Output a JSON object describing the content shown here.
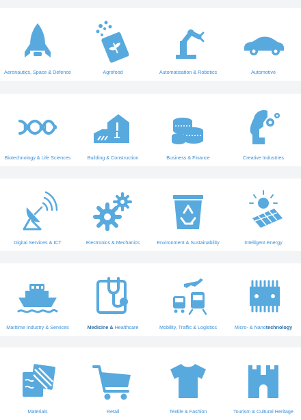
{
  "rows": [
    {
      "tiles": [
        {
          "label": "Aeronautics, Space & Defence",
          "icon": "rocket-icon"
        },
        {
          "label": "Agrofood",
          "icon": "seed-bag-icon"
        },
        {
          "label": "Automatisation & Robotics",
          "icon": "robot-arm-icon"
        },
        {
          "label": "Automotive",
          "icon": "car-icon"
        }
      ]
    },
    {
      "tiles": [
        {
          "label": "Biotechnology & Life Sciences",
          "icon": "dna-icon"
        },
        {
          "label": "Building & Construction",
          "icon": "house-construction-icon"
        },
        {
          "label": "Business & Finance",
          "icon": "coin-stacks-icon"
        },
        {
          "label": "Creative Industries",
          "icon": "head-gears-icon"
        }
      ]
    },
    {
      "tiles": [
        {
          "label": "Digital Services & ICT",
          "icon": "satellite-dish-icon"
        },
        {
          "label": "Electronics & Mechanics",
          "icon": "gears-icon"
        },
        {
          "label": "Environment & Sustainability",
          "icon": "recycle-bin-icon"
        },
        {
          "label": "Intelligent Energy",
          "icon": "solar-panel-icon"
        }
      ]
    },
    {
      "tiles": [
        {
          "label": "Maritime Industry & Services",
          "icon": "ship-icon"
        },
        {
          "label_bold": "Medicine &",
          "label_rest": " Healthcare",
          "icon": "stethoscope-icon"
        },
        {
          "label": "Mobility, Traffic & Logistics",
          "icon": "plane-bus-train-icon"
        },
        {
          "label_rest": "Micro- & Nano",
          "label_bold": "technology",
          "icon": "chip-icon"
        }
      ]
    },
    {
      "tiles": [
        {
          "label": "Materials",
          "icon": "material-swatches-icon"
        },
        {
          "label": "Retail",
          "icon": "shopping-cart-icon"
        },
        {
          "label": "Textile & Fashion",
          "icon": "tshirt-icon"
        },
        {
          "label": "Tourism & Cultural Heritage",
          "icon": "castle-icon"
        }
      ]
    }
  ],
  "colors": {
    "icon": "#58a9de",
    "label": "#3a8fd6",
    "background": "#f3f4f6"
  }
}
